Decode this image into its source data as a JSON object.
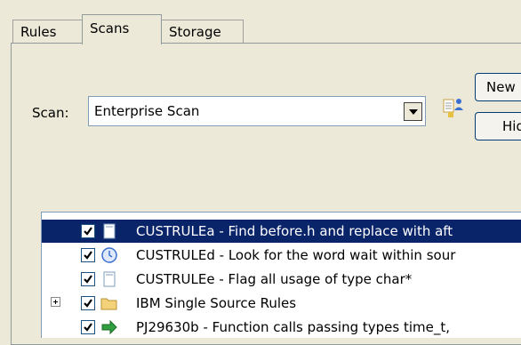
{
  "tabs": [
    {
      "label": "Rules"
    },
    {
      "label": "Scans"
    },
    {
      "label": "Storage"
    }
  ],
  "scan": {
    "label": "Scan:",
    "value": "Enterprise Scan"
  },
  "buttons": {
    "new_label": "New",
    "hide_label": "Hide"
  },
  "list": {
    "items": [
      {
        "text": "CUSTRULEa - Find before.h and replace with aft",
        "icon": "document-icon",
        "checked": true,
        "selected": true
      },
      {
        "text": "CUSTRULEd - Look for the word wait within sour",
        "icon": "clock-icon",
        "checked": true,
        "selected": false
      },
      {
        "text": "CUSTRULEe - Flag all usage of type char*",
        "icon": "document-icon",
        "checked": true,
        "selected": false
      },
      {
        "text": "IBM Single Source Rules",
        "icon": "folder-icon",
        "checked": true,
        "selected": false
      },
      {
        "text": "PJ29630b - Function calls passing types time_t,",
        "icon": "arrow-icon",
        "checked": true,
        "selected": false
      }
    ]
  }
}
